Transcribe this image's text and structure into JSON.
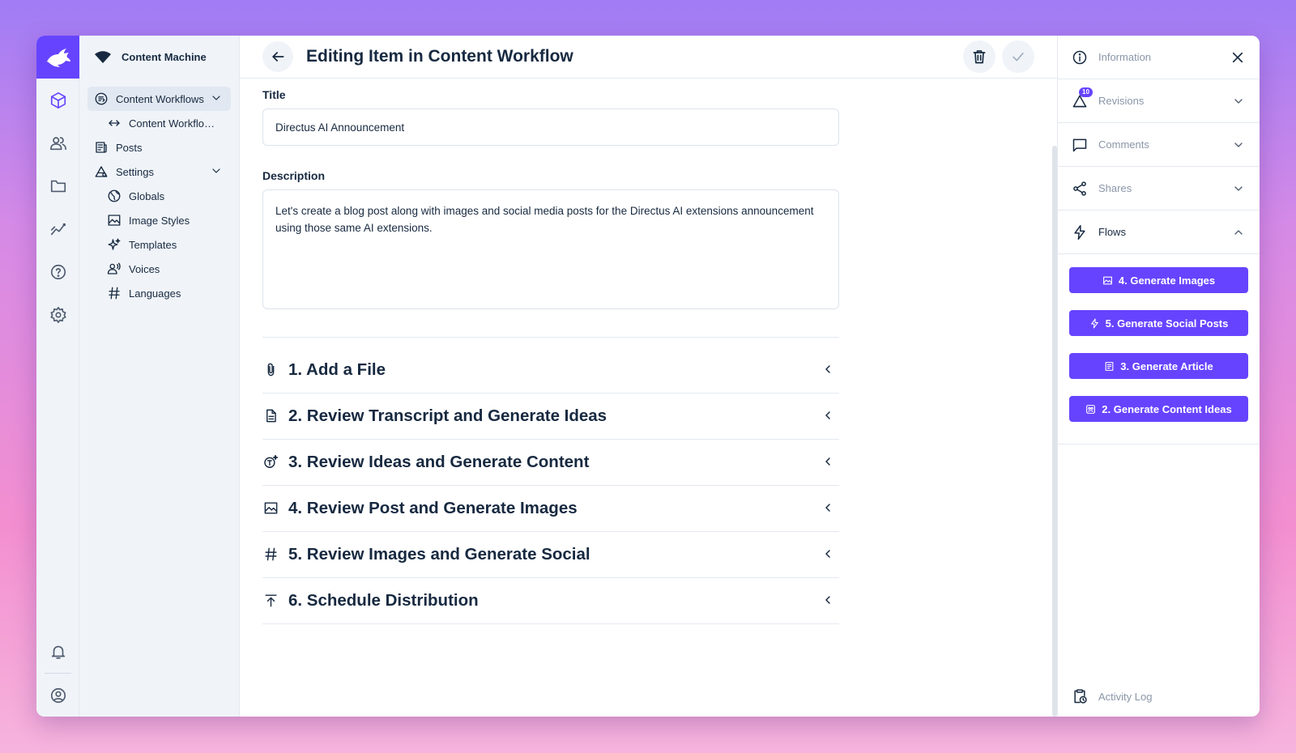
{
  "colors": {
    "accent": "#6644ff",
    "text": "#172940",
    "muted": "#8a96a8",
    "nav_bg": "#f0f4f9"
  },
  "module_bar": {
    "items": [
      {
        "name": "content-module",
        "icon": "cube-icon",
        "active": true
      },
      {
        "name": "users-module",
        "icon": "users-icon"
      },
      {
        "name": "files-module",
        "icon": "folder-icon"
      },
      {
        "name": "insights-module",
        "icon": "insights-icon"
      },
      {
        "name": "help-module",
        "icon": "help-icon"
      },
      {
        "name": "settings-module",
        "icon": "gear-icon"
      }
    ],
    "bottom": [
      "bell-icon",
      "account-icon"
    ]
  },
  "nav": {
    "project_name": "Content Machine",
    "items": [
      {
        "label": "Content Workflows",
        "icon": "workflow-icon",
        "expanded": true,
        "active": true
      },
      {
        "label": "Content Workflow Items",
        "icon": "swap-icon",
        "sub": true
      },
      {
        "label": "Posts",
        "icon": "posts-icon"
      },
      {
        "label": "Settings",
        "icon": "settings-icon",
        "expanded": true
      },
      {
        "label": "Globals",
        "icon": "globe-icon",
        "sub": true
      },
      {
        "label": "Image Styles",
        "icon": "image-icon",
        "sub": true
      },
      {
        "label": "Templates",
        "icon": "sparkle-icon",
        "sub": true
      },
      {
        "label": "Voices",
        "icon": "voice-icon",
        "sub": true
      },
      {
        "label": "Languages",
        "icon": "hash-icon",
        "sub": true
      }
    ]
  },
  "header": {
    "title": "Editing Item in Content Workflow"
  },
  "form": {
    "title_label": "Title",
    "title_value": "Directus AI Announcement",
    "description_label": "Description",
    "description_value": "Let's create a blog post along with images and social media posts for the Directus AI extensions announcement using those same AI extensions.",
    "groups": [
      {
        "title": "1. Add a File",
        "icon": "paperclip-icon"
      },
      {
        "title": "2. Review Transcript and Generate Ideas",
        "icon": "document-icon"
      },
      {
        "title": "3. Review Ideas and Generate Content",
        "icon": "ai-text-icon"
      },
      {
        "title": "4. Review Post and Generate Images",
        "icon": "image-icon"
      },
      {
        "title": "5. Review Images and Generate Social",
        "icon": "hash-icon"
      },
      {
        "title": "6. Schedule Distribution",
        "icon": "publish-icon"
      }
    ]
  },
  "sidebar": {
    "information": "Information",
    "revisions": "Revisions",
    "revisions_count": "10",
    "comments": "Comments",
    "shares": "Shares",
    "flows": "Flows",
    "flow_buttons": [
      {
        "label": "4. Generate Images",
        "icon": "image-icon"
      },
      {
        "label": "5. Generate Social Posts",
        "icon": "bolt-icon"
      },
      {
        "label": "3. Generate Article",
        "icon": "article-icon"
      },
      {
        "label": "2. Generate Content Ideas",
        "icon": "ideas-icon"
      }
    ],
    "activity_log": "Activity Log"
  }
}
